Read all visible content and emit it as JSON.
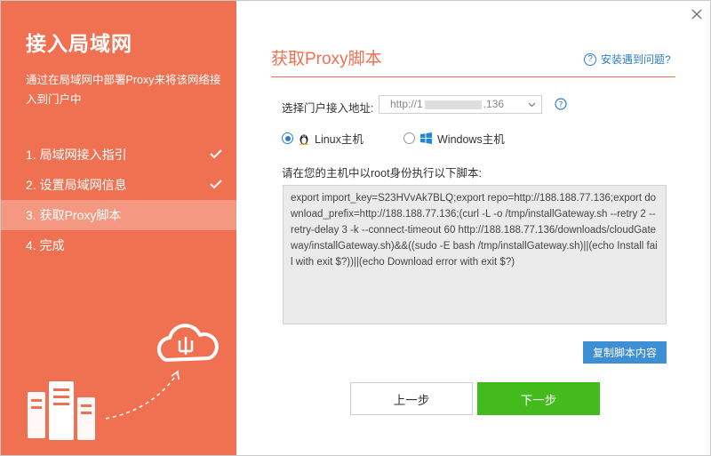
{
  "sidebar": {
    "title": "接入局域网",
    "description": "通过在局域网中部署Proxy来将该网络接入到门户中",
    "steps": [
      {
        "label": "1. 局域网接入指引",
        "done": true
      },
      {
        "label": "2. 设置局域网信息",
        "done": true
      },
      {
        "label": "3. 获取Proxy脚本",
        "active": true
      },
      {
        "label": "4. 完成"
      }
    ]
  },
  "main": {
    "title": "获取Proxy脚本",
    "help_link": "安装遇到问题?",
    "address_label": "选择门户接入地址:",
    "address_prefix": "http://1",
    "address_suffix": ".136",
    "os_options": [
      {
        "label": "Linux主机",
        "checked": true,
        "icon": "linux-penguin-icon"
      },
      {
        "label": "Windows主机",
        "checked": false,
        "icon": "windows-logo-icon"
      }
    ],
    "command_label": "请在您的主机中以root身份执行以下脚本:",
    "command": "export import_key=S23HVvAk7BLQ;export repo=http://188.188.77.136;export download_prefix=http://188.188.77.136;(curl -L -o /tmp/installGateway.sh --retry 2 --retry-delay 3 -k --connect-timeout 60 http://188.188.77.136/downloads/cloudGateway/installGateway.sh)&&((sudo -E bash /tmp/installGateway.sh)||(echo Install fail with exit $?))||(echo Download error with exit $?)",
    "copy_button": "复制脚本内容",
    "prev_button": "上一步",
    "next_button": "下一步"
  },
  "colors": {
    "accent": "#f07152",
    "link": "#2a7ec8",
    "next": "#43bb1c",
    "copy": "#3e8ed4"
  }
}
